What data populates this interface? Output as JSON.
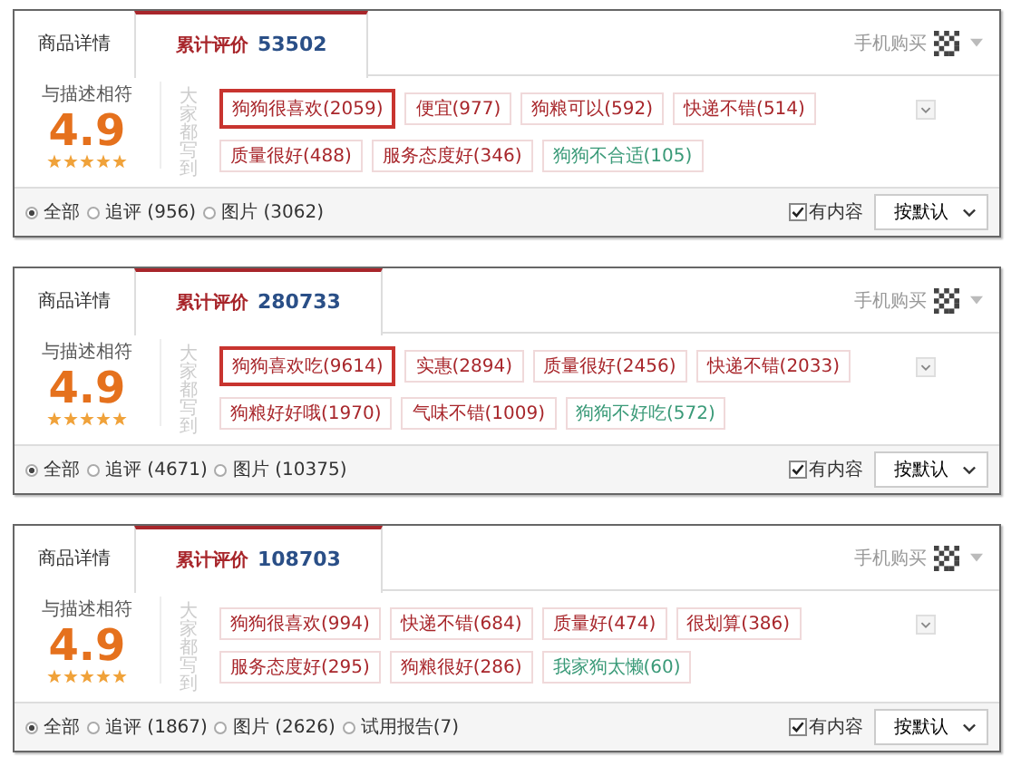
{
  "panels": [
    {
      "tabs": [
        {
          "label": "商品详情",
          "selected": false
        },
        {
          "label": "累计评价",
          "count": "53502",
          "selected": true
        }
      ],
      "mobile_buy": "手机购买",
      "rating": {
        "label": "与描述相符",
        "score": "4.9",
        "stars": 5
      },
      "tags_heading": "大家都写到",
      "tags": [
        {
          "text": "狗狗很喜欢(2059)",
          "color": "#a8262b",
          "highlighted": true
        },
        {
          "text": "便宜(977)",
          "color": "#a8262b",
          "highlighted": false
        },
        {
          "text": "狗粮可以(592)",
          "color": "#a8262b",
          "highlighted": false
        },
        {
          "text": "快递不错(514)",
          "color": "#a8262b",
          "highlighted": false
        },
        {
          "text": "质量很好(488)",
          "color": "#a8262b",
          "highlighted": false
        },
        {
          "text": "服务态度好(346)",
          "color": "#a8262b",
          "highlighted": false
        },
        {
          "text": "狗狗不合适(105)",
          "color": "#3a9a78",
          "highlighted": false
        }
      ],
      "filters": [
        {
          "label": "全部",
          "selected": true
        },
        {
          "label": "追评 (956)",
          "selected": false
        },
        {
          "label": "图片 (3062)",
          "selected": false
        }
      ],
      "has_content": {
        "label": "有内容",
        "checked": true
      },
      "sort": "按默认"
    },
    {
      "tabs": [
        {
          "label": "商品详情",
          "selected": false
        },
        {
          "label": "累计评价",
          "count": "280733",
          "selected": true
        }
      ],
      "mobile_buy": "手机购买",
      "rating": {
        "label": "与描述相符",
        "score": "4.9",
        "stars": 5
      },
      "tags_heading": "大家都写到",
      "tags": [
        {
          "text": "狗狗喜欢吃(9614)",
          "color": "#a8262b",
          "highlighted": true
        },
        {
          "text": "实惠(2894)",
          "color": "#a8262b",
          "highlighted": false
        },
        {
          "text": "质量很好(2456)",
          "color": "#a8262b",
          "highlighted": false
        },
        {
          "text": "快递不错(2033)",
          "color": "#a8262b",
          "highlighted": false
        },
        {
          "text": "狗粮好好哦(1970)",
          "color": "#a8262b",
          "highlighted": false
        },
        {
          "text": "气味不错(1009)",
          "color": "#a8262b",
          "highlighted": false
        },
        {
          "text": "狗狗不好吃(572)",
          "color": "#3a9a78",
          "highlighted": false
        }
      ],
      "filters": [
        {
          "label": "全部",
          "selected": true
        },
        {
          "label": "追评 (4671)",
          "selected": false
        },
        {
          "label": "图片 (10375)",
          "selected": false
        }
      ],
      "has_content": {
        "label": "有内容",
        "checked": true
      },
      "sort": "按默认"
    },
    {
      "tabs": [
        {
          "label": "商品详情",
          "selected": false
        },
        {
          "label": "累计评价",
          "count": "108703",
          "selected": true
        }
      ],
      "mobile_buy": "手机购买",
      "rating": {
        "label": "与描述相符",
        "score": "4.9",
        "stars": 5
      },
      "tags_heading": "大家都写到",
      "tags": [
        {
          "text": "狗狗很喜欢(994)",
          "color": "#a8262b",
          "highlighted": false
        },
        {
          "text": "快递不错(684)",
          "color": "#a8262b",
          "highlighted": false
        },
        {
          "text": "质量好(474)",
          "color": "#a8262b",
          "highlighted": false
        },
        {
          "text": "很划算(386)",
          "color": "#a8262b",
          "highlighted": false
        },
        {
          "text": "服务态度好(295)",
          "color": "#a8262b",
          "highlighted": false
        },
        {
          "text": "狗粮很好(286)",
          "color": "#a8262b",
          "highlighted": false
        },
        {
          "text": "我家狗太懒(60)",
          "color": "#3a9a78",
          "highlighted": false
        }
      ],
      "filters": [
        {
          "label": "全部",
          "selected": true
        },
        {
          "label": "追评 (1867)",
          "selected": false
        },
        {
          "label": "图片 (2626)",
          "selected": false
        },
        {
          "label": "试用报告(7)",
          "selected": false
        }
      ],
      "has_content": {
        "label": "有内容",
        "checked": true
      },
      "sort": "按默认"
    }
  ]
}
